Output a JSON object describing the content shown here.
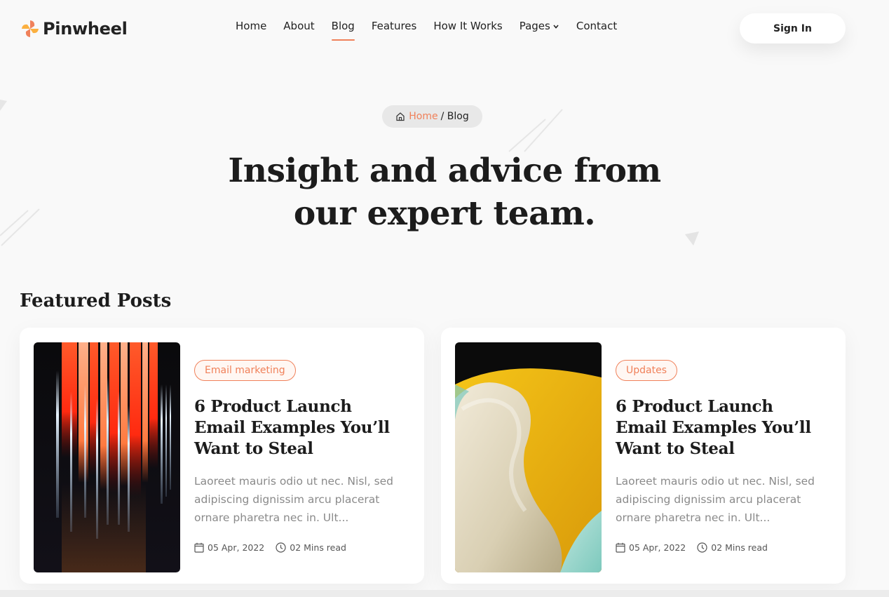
{
  "brand": {
    "name": "Pinwheel",
    "accent": "#f0815a"
  },
  "nav": {
    "items": [
      {
        "label": "Home"
      },
      {
        "label": "About"
      },
      {
        "label": "Blog",
        "active": true
      },
      {
        "label": "Features"
      },
      {
        "label": "How It Works"
      },
      {
        "label": "Pages",
        "dropdown": true
      },
      {
        "label": "Contact"
      }
    ],
    "signin_label": "Sign In"
  },
  "hero": {
    "breadcrumb": {
      "home": "Home",
      "current": "/ Blog"
    },
    "title_line1": "Insight and advice from",
    "title_line2": "our expert team."
  },
  "featured": {
    "heading": "Featured Posts",
    "posts": [
      {
        "tag": "Email marketing",
        "title": "6 Product Launch Email Examples You’ll Want to Steal",
        "excerpt": "Laoreet mauris odio ut nec. Nisl, sed adipiscing dignissim arcu placerat ornare pharetra nec in. Ult...",
        "date": "05 Apr, 2022",
        "read_time": "02 Mins read",
        "image": "abstract-light-streaks"
      },
      {
        "tag": "Updates",
        "title": "6 Product Launch Email Examples You’ll Want to Steal",
        "excerpt": "Laoreet mauris odio ut nec. Nisl, sed adipiscing dignissim arcu placerat ornare pharetra nec in. Ult...",
        "date": "05 Apr, 2022",
        "read_time": "02 Mins read",
        "image": "abstract-3d-shapes"
      }
    ]
  }
}
